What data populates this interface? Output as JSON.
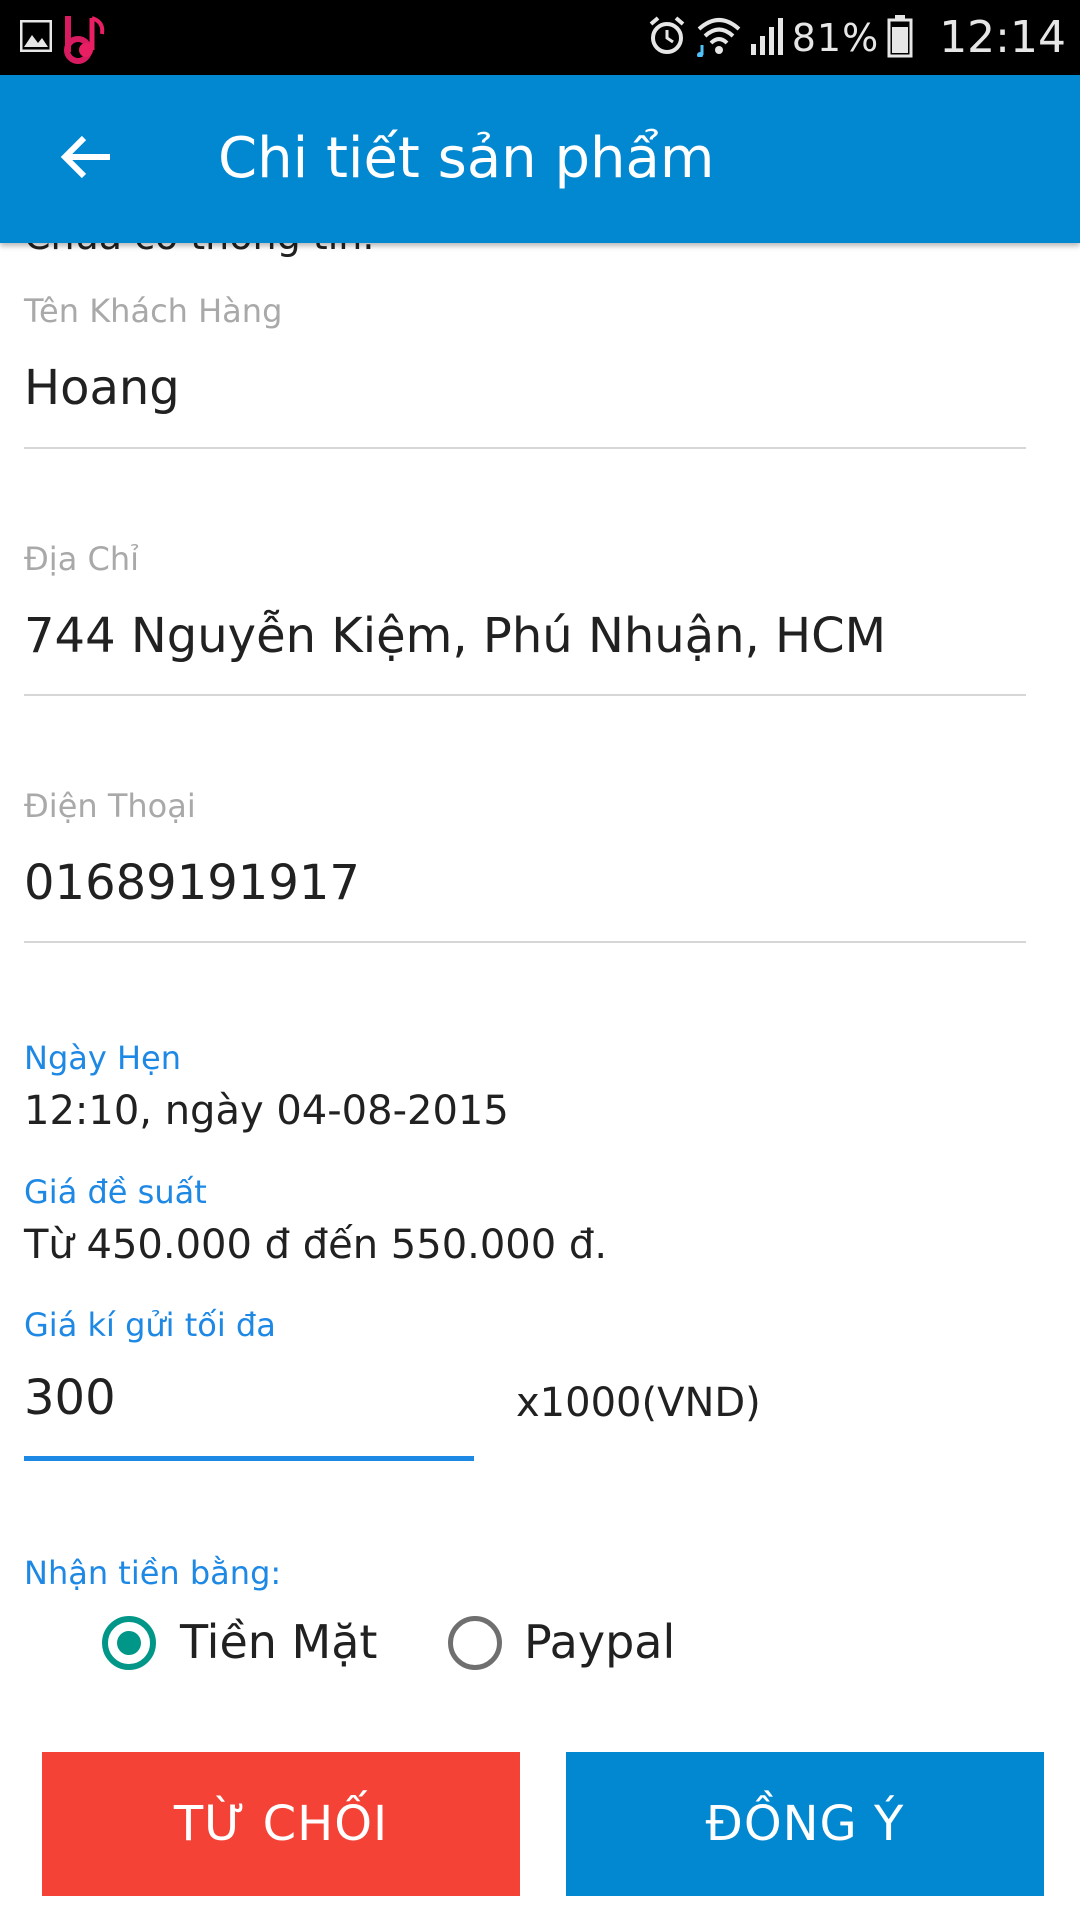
{
  "status_bar": {
    "battery_percent": "81%",
    "time": "12:14",
    "icons": [
      "gallery-icon",
      "music-app-icon",
      "alarm-icon",
      "wifi-icon",
      "signal-icon",
      "battery-icon"
    ]
  },
  "app_bar": {
    "title": "Chi tiết sản phẩm",
    "background": "#0288d1"
  },
  "clipped_text": "Chưa có thông tin.",
  "fields": {
    "customer_name": {
      "label": "Tên Khách Hàng",
      "value": "Hoang"
    },
    "address": {
      "label": "Địa Chỉ",
      "value": "744 Nguyễn Kiệm, Phú Nhuận, HCM"
    },
    "phone": {
      "label": "Điện Thoại",
      "value": "01689191917"
    }
  },
  "appointment": {
    "label": "Ngày Hẹn",
    "value": "12:10, ngày 04-08-2015"
  },
  "suggested_price": {
    "label": "Giá đề suất",
    "value": "Từ 450.000 đ đến 550.000 đ."
  },
  "max_price": {
    "label": "Giá kí gửi tối đa",
    "value": "300",
    "unit": "x1000(VND)"
  },
  "payment": {
    "label": "Nhận tiền bằng:",
    "options": [
      {
        "label": "Tiền Mặt",
        "selected": true
      },
      {
        "label": "Paypal",
        "selected": false
      }
    ]
  },
  "buttons": {
    "reject": "TỪ CHỐI",
    "accept": "ĐỒNG Ý"
  },
  "colors": {
    "accent_blue": "#1e88e5",
    "radio_checked": "#009688",
    "reject_red": "#f44336",
    "accept_blue": "#0288d1"
  }
}
